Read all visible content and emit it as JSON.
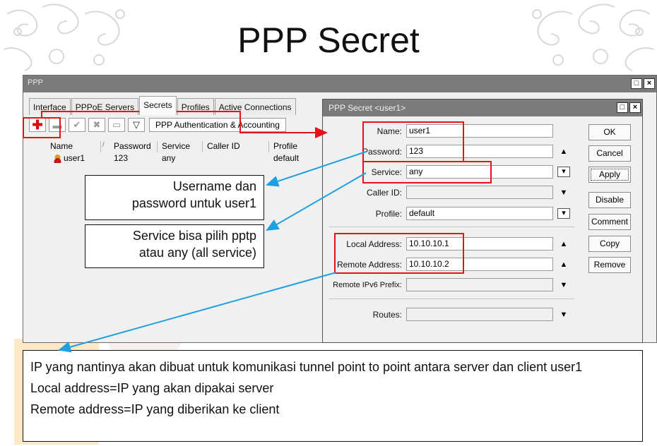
{
  "slide": {
    "title": "PPP Secret"
  },
  "ppp_window": {
    "title": "PPP",
    "controls": [
      "□",
      "×"
    ],
    "tabs": [
      {
        "label": "Interface",
        "active": false
      },
      {
        "label": "PPPoE Servers",
        "active": false
      },
      {
        "label": "Secrets",
        "active": true
      },
      {
        "label": "Profiles",
        "active": false
      },
      {
        "label": "Active Connections",
        "active": false
      }
    ],
    "toolbar": {
      "wide_button": "PPP Authentication & Accounting"
    },
    "table": {
      "headers": [
        "Name",
        "/",
        "Password",
        "Service",
        "Caller ID",
        "Profile"
      ],
      "rows": [
        {
          "name": "user1",
          "password": "123",
          "service": "any",
          "caller_id": "",
          "profile": "default"
        }
      ]
    }
  },
  "secret_dialog": {
    "title": "PPP Secret <user1>",
    "controls": [
      "□",
      "×"
    ],
    "fields": {
      "name": {
        "label": "Name:",
        "value": "user1"
      },
      "password": {
        "label": "Password:",
        "value": "123"
      },
      "service": {
        "label": "Service:",
        "value": "any"
      },
      "caller_id": {
        "label": "Caller ID:",
        "value": ""
      },
      "profile": {
        "label": "Profile:",
        "value": "default"
      },
      "local_address": {
        "label": "Local Address:",
        "value": "10.10.10.1"
      },
      "remote_address": {
        "label": "Remote Address:",
        "value": "10.10.10.2"
      },
      "remote_ipv6_prefix": {
        "label": "Remote IPv6 Prefix:",
        "value": ""
      },
      "routes": {
        "label": "Routes:",
        "value": ""
      }
    },
    "buttons": {
      "ok": "OK",
      "cancel": "Cancel",
      "apply": "Apply",
      "disable": "Disable",
      "comment": "Comment",
      "copy": "Copy",
      "remove": "Remove"
    }
  },
  "callouts": {
    "username_line1": "Username dan",
    "username_line2": "password untuk user1",
    "service_line1": "Service bisa pilih pptp",
    "service_line2": "atau any (all service)"
  },
  "note": {
    "line1": "IP yang nantinya akan dibuat untuk komunikasi tunnel point to point antara server dan client user1",
    "line2": "Local address=IP yang akan dipakai server",
    "line3": "Remote address=IP yang diberikan ke client"
  },
  "colors": {
    "highlight": "#e8101c",
    "arrow": "#1ea0e0",
    "titlebar": "#7b7b7b"
  },
  "icons": [
    "add-icon",
    "remove-icon",
    "check-icon",
    "cross-icon",
    "comment-icon",
    "filter-icon",
    "user-icon"
  ]
}
